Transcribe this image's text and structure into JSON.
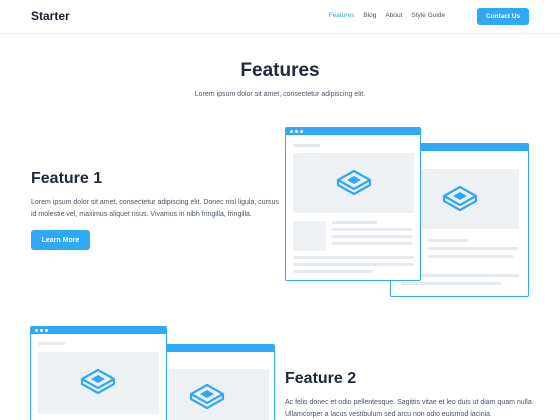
{
  "header": {
    "logo": "Starter",
    "nav": [
      {
        "label": "Features",
        "active": true
      },
      {
        "label": "Blog",
        "active": false
      },
      {
        "label": "About",
        "active": false
      },
      {
        "label": "Style Guide",
        "active": false
      }
    ],
    "cta_label": "Contact Us"
  },
  "hero": {
    "title": "Features",
    "subtitle": "Lorem ipsum dolor sit amet, consectetur adipiscing elit."
  },
  "features": [
    {
      "title": "Feature 1",
      "text_lines": [
        "Lorem ipsum dolor sit amet, consectetur adipiscing elit. Donec nisl ligula, cursus",
        "id molestie vel, maximus aliquet risus. Vivamus in nibh fringilla, fringilla."
      ],
      "button_label": "Learn More"
    },
    {
      "title": "Feature 2",
      "text_lines": [
        "Ac felis donec et odio pellentesque. Sagittis vitae et leo duis ut diam quam nulla.",
        "Ullamcorper a lacus vestibulum sed arcu non odio euismod lacinia."
      ]
    }
  ],
  "colors": {
    "accent": "#2fa8f5",
    "heading": "#1f2937",
    "body_text": "#4a5568",
    "placeholder": "#eef1f4"
  },
  "icons": [
    "browser-window-illustration",
    "cube-icon"
  ]
}
